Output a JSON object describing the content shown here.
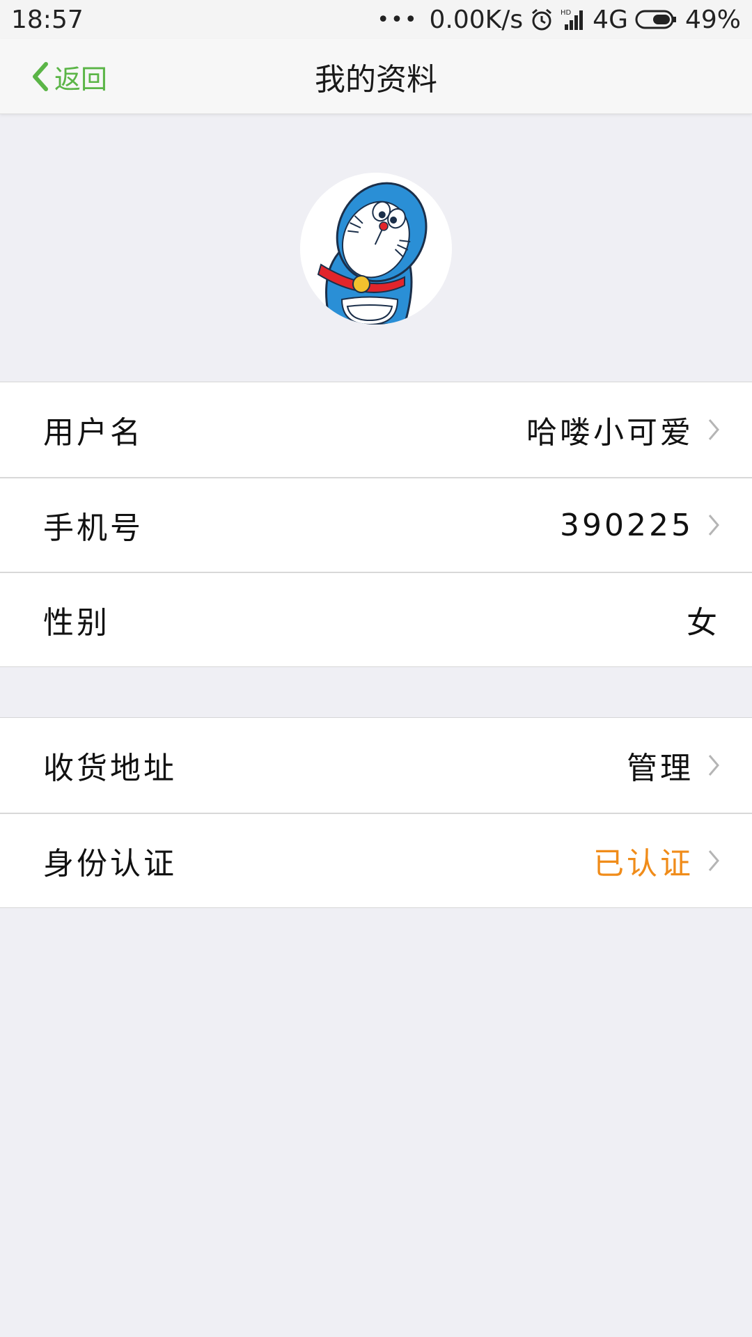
{
  "status_bar": {
    "time": "18:57",
    "dots": "•••",
    "net_speed": "0.00K/s",
    "network": "4G",
    "battery": "49%"
  },
  "nav": {
    "back_label": "返回",
    "title": "我的资料"
  },
  "profile": {
    "avatar_icon": "doraemon-avatar"
  },
  "section1": [
    {
      "label": "用户名",
      "value": "哈喽小可爱",
      "chevron": true
    },
    {
      "label": "手机号",
      "value": "390225",
      "chevron": true
    },
    {
      "label": "性别",
      "value": "女",
      "chevron": false
    }
  ],
  "section2": [
    {
      "label": "收货地址",
      "value": "管理",
      "chevron": true
    },
    {
      "label": "身份认证",
      "value": "已认证",
      "chevron": true,
      "value_color": "#f08c1a"
    }
  ],
  "colors": {
    "accent_green": "#5bb547",
    "verified_orange": "#f08c1a",
    "background": "#efeff4"
  }
}
